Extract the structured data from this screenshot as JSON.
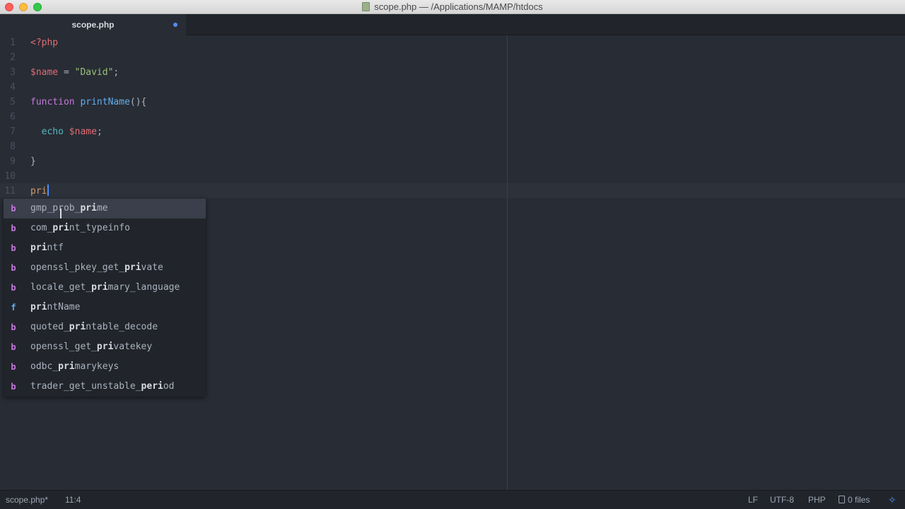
{
  "window": {
    "title": "scope.php — /Applications/MAMP/htdocs",
    "file_icon": "php-file-icon"
  },
  "tabs": [
    {
      "label": "scope.php",
      "modified": true
    }
  ],
  "editor": {
    "lines": [
      {
        "num": "1",
        "tokens": [
          {
            "t": "<?php",
            "c": "tag"
          }
        ]
      },
      {
        "num": "2",
        "tokens": []
      },
      {
        "num": "3",
        "tokens": [
          {
            "t": "$name",
            "c": "var"
          },
          {
            "t": " = ",
            "c": "plain"
          },
          {
            "t": "\"David\"",
            "c": "str"
          },
          {
            "t": ";",
            "c": "plain"
          }
        ]
      },
      {
        "num": "4",
        "tokens": []
      },
      {
        "num": "5",
        "tokens": [
          {
            "t": "function",
            "c": "kw"
          },
          {
            "t": " ",
            "c": "plain"
          },
          {
            "t": "printName",
            "c": "fn"
          },
          {
            "t": "(){",
            "c": "plain"
          }
        ]
      },
      {
        "num": "6",
        "tokens": []
      },
      {
        "num": "7",
        "tokens": [
          {
            "t": "  ",
            "c": "plain"
          },
          {
            "t": "echo",
            "c": "echo"
          },
          {
            "t": " ",
            "c": "plain"
          },
          {
            "t": "$name",
            "c": "var"
          },
          {
            "t": ";",
            "c": "plain"
          }
        ]
      },
      {
        "num": "8",
        "tokens": []
      },
      {
        "num": "9",
        "tokens": [
          {
            "t": "}",
            "c": "plain"
          }
        ]
      },
      {
        "num": "10",
        "tokens": []
      },
      {
        "num": "11",
        "tokens": [
          {
            "t": "pri",
            "c": "typed"
          }
        ],
        "cursor": true
      }
    ]
  },
  "autocomplete": {
    "items": [
      {
        "type": "b",
        "before": "gmp_prob_",
        "match": "pri",
        "after": "me",
        "selected": true
      },
      {
        "type": "b",
        "before": "com_",
        "match": "pri",
        "after": "nt_typeinfo"
      },
      {
        "type": "b",
        "before": "",
        "match": "pri",
        "after": "ntf"
      },
      {
        "type": "b",
        "before": "openssl_pkey_get_",
        "match": "pri",
        "after": "vate"
      },
      {
        "type": "b",
        "before": "locale_get_",
        "match": "pri",
        "after": "mary_language"
      },
      {
        "type": "f",
        "before": "",
        "match": "pri",
        "after": "ntName"
      },
      {
        "type": "b",
        "before": "quoted_",
        "match": "pri",
        "after": "ntable_decode"
      },
      {
        "type": "b",
        "before": "openssl_get_",
        "match": "pri",
        "after": "vatekey"
      },
      {
        "type": "b",
        "before": "odbc_",
        "match": "pri",
        "after": "marykeys"
      },
      {
        "type": "b",
        "before": "trader_get_unstable_",
        "match": "peri",
        "after": "od"
      }
    ]
  },
  "status": {
    "file": "scope.php*",
    "position": "11:4",
    "line_ending": "LF",
    "encoding": "UTF-8",
    "grammar": "PHP",
    "files": "0 files"
  },
  "colors": {
    "background": "#282c34",
    "accent": "#568af2"
  }
}
